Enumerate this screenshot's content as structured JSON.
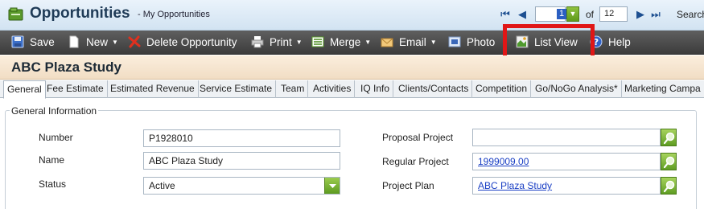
{
  "header": {
    "title": "Opportunities",
    "subtitle": "- My Opportunities",
    "pager": {
      "current": "1",
      "of_label": "of",
      "total": "12"
    },
    "search_label": "Search"
  },
  "toolbar": {
    "save": "Save",
    "new": "New",
    "delete": "Delete Opportunity",
    "print": "Print",
    "merge": "Merge",
    "email": "Email",
    "photo": "Photo",
    "list_view": "List View",
    "help": "Help"
  },
  "record": {
    "title": "ABC Plaza Study"
  },
  "tabs": [
    {
      "label": "General"
    },
    {
      "label": "Fee Estimate"
    },
    {
      "label": "Estimated Revenue"
    },
    {
      "label": "Service Estimate"
    },
    {
      "label": "Team"
    },
    {
      "label": "Activities"
    },
    {
      "label": "IQ Info"
    },
    {
      "label": "Clients/Contacts"
    },
    {
      "label": "Competition"
    },
    {
      "label": "Go/NoGo Analysis*"
    },
    {
      "label": "Marketing Campa"
    }
  ],
  "general": {
    "legend": "General Information",
    "number": {
      "label": "Number",
      "value": "P1928010"
    },
    "name": {
      "label": "Name",
      "value": "ABC Plaza Study"
    },
    "status": {
      "label": "Status",
      "value": "Active"
    },
    "proposal_project": {
      "label": "Proposal Project",
      "value": ""
    },
    "regular_project": {
      "label": "Regular Project",
      "value": "1999009.00"
    },
    "project_plan": {
      "label": "Project Plan",
      "value": "ABC Plaza Study"
    }
  },
  "colors": {
    "toolbar_bg": "#4a4a4a",
    "highlight": "#e01616",
    "accent_green": "#6aa526",
    "link": "#1a3fc4"
  }
}
